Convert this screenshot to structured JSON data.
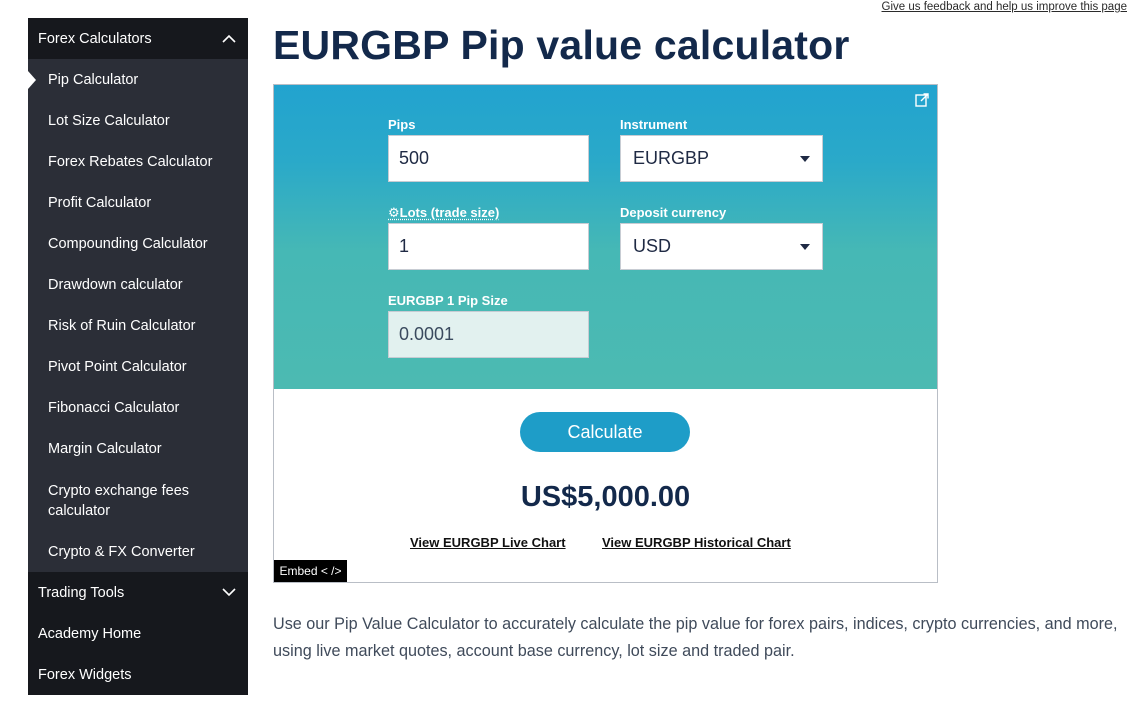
{
  "feedback": {
    "label": "Give us feedback and help us improve this page"
  },
  "sidebar": {
    "section_forex": "Forex Calculators",
    "items": [
      {
        "label": "Pip Calculator"
      },
      {
        "label": "Lot Size Calculator"
      },
      {
        "label": "Forex Rebates Calculator"
      },
      {
        "label": "Profit Calculator"
      },
      {
        "label": "Compounding Calculator"
      },
      {
        "label": "Drawdown calculator"
      },
      {
        "label": "Risk of Ruin Calculator"
      },
      {
        "label": "Pivot Point Calculator"
      },
      {
        "label": "Fibonacci Calculator"
      },
      {
        "label": "Margin Calculator"
      },
      {
        "label": "Crypto exchange fees calculator"
      },
      {
        "label": "Crypto & FX Converter"
      }
    ],
    "section_tools": "Trading Tools",
    "academy": "Academy Home",
    "widgets": "Forex Widgets"
  },
  "page": {
    "title": "EURGBP Pip value calculator"
  },
  "calculator": {
    "pips_label": "Pips",
    "pips_value": "500",
    "instrument_label": "Instrument",
    "instrument_value": "EURGBP",
    "lots_label": "⚙Lots (trade size)",
    "lots_value": "1",
    "deposit_label": "Deposit currency",
    "deposit_value": "USD",
    "pipsize_label": "EURGBP 1 Pip Size",
    "pipsize_value": "0.0001",
    "calculate_label": "Calculate",
    "result": "US$5,000.00",
    "live_chart_link": "View EURGBP Live Chart",
    "historical_chart_link": "View EURGBP Historical Chart",
    "embed_label": "Embed < />"
  },
  "description": "Use our Pip Value Calculator to accurately calculate the pip value for forex pairs, indices, crypto currencies, and more, using live market quotes, account base currency, lot size and traded pair."
}
